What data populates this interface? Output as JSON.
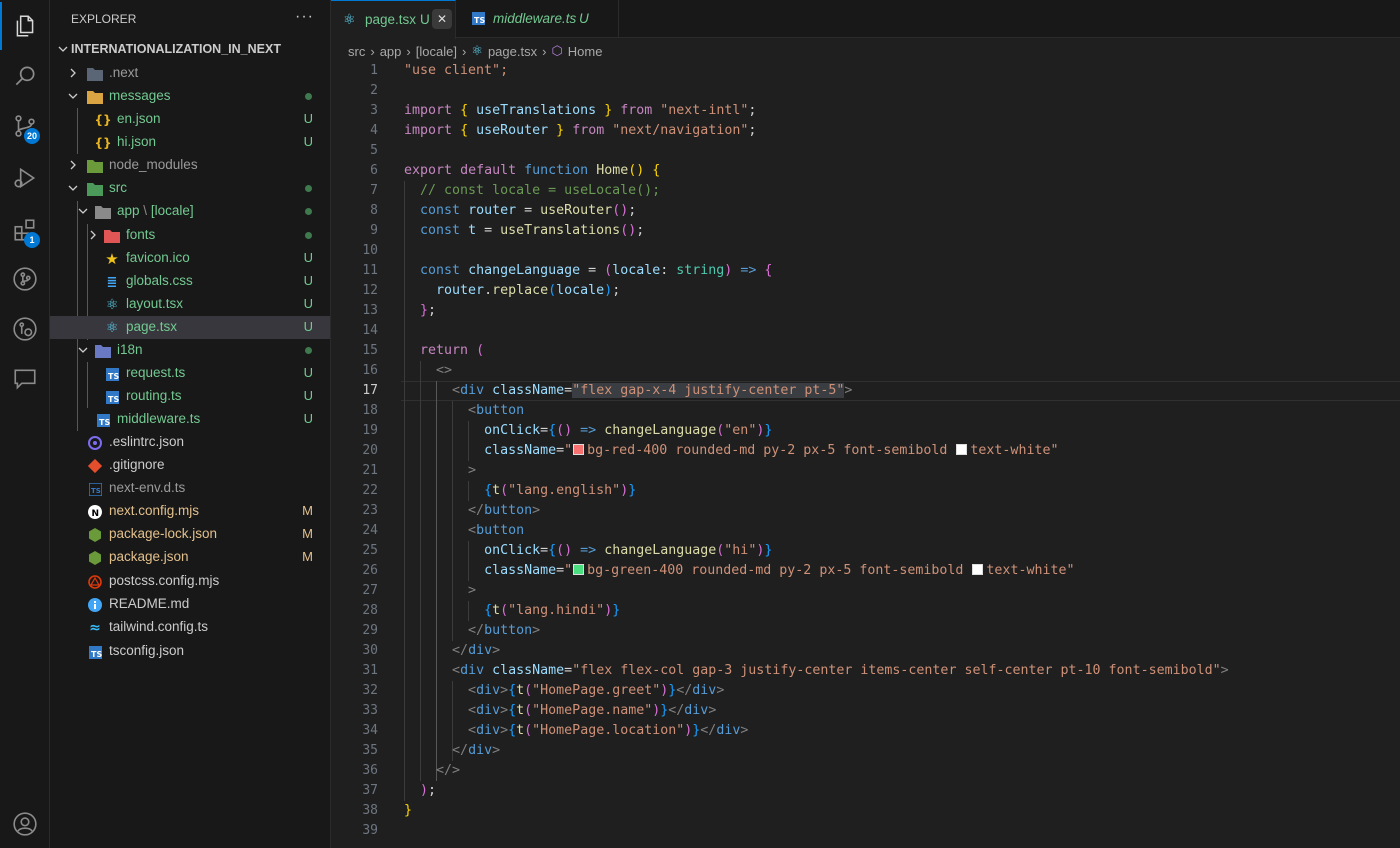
{
  "activity_bar": {
    "items": [
      {
        "name": "explorer-icon",
        "badge": ""
      },
      {
        "name": "search-icon",
        "badge": ""
      },
      {
        "name": "source-control-icon",
        "badge": "20"
      },
      {
        "name": "run-debug-icon",
        "badge": ""
      },
      {
        "name": "extensions-icon",
        "badge": "1"
      },
      {
        "name": "git-graph-icon",
        "badge": ""
      },
      {
        "name": "remote-explorer-icon",
        "badge": ""
      },
      {
        "name": "chat-icon",
        "badge": ""
      }
    ],
    "account_icon": "account-icon"
  },
  "sidebar": {
    "title": "EXPLORER",
    "more": "···",
    "root": "INTERNATIONALIZATION_IN_NEXT",
    "items": [
      {
        "name": ".next",
        "status": ""
      },
      {
        "name": "messages",
        "status": ""
      },
      {
        "name": "en.json",
        "status": "U"
      },
      {
        "name": "hi.json",
        "status": "U"
      },
      {
        "name": "node_modules",
        "status": ""
      },
      {
        "name": "src",
        "status": ""
      },
      {
        "name": "app",
        "sep": "\\",
        "sub": "[locale]",
        "status": ""
      },
      {
        "name": "fonts",
        "status": ""
      },
      {
        "name": "favicon.ico",
        "status": "U"
      },
      {
        "name": "globals.css",
        "status": "U"
      },
      {
        "name": "layout.tsx",
        "status": "U"
      },
      {
        "name": "page.tsx",
        "status": "U"
      },
      {
        "name": "i18n",
        "status": ""
      },
      {
        "name": "request.ts",
        "status": "U"
      },
      {
        "name": "routing.ts",
        "status": "U"
      },
      {
        "name": "middleware.ts",
        "status": "U"
      },
      {
        "name": ".eslintrc.json",
        "status": ""
      },
      {
        "name": ".gitignore",
        "status": ""
      },
      {
        "name": "next-env.d.ts",
        "status": ""
      },
      {
        "name": "next.config.mjs",
        "status": "M"
      },
      {
        "name": "package-lock.json",
        "status": "M"
      },
      {
        "name": "package.json",
        "status": "M"
      },
      {
        "name": "postcss.config.mjs",
        "status": ""
      },
      {
        "name": "README.md",
        "status": ""
      },
      {
        "name": "tailwind.config.ts",
        "status": ""
      },
      {
        "name": "tsconfig.json",
        "status": ""
      }
    ]
  },
  "tabs": [
    {
      "label": "page.tsx",
      "status": "U",
      "close": "✕"
    },
    {
      "label": "middleware.ts",
      "status": "U"
    }
  ],
  "breadcrumb": [
    "src",
    "app",
    "[locale]",
    "page.tsx",
    "Home"
  ],
  "editor": {
    "current_line": "17",
    "line_numbers": [
      "1",
      "2",
      "3",
      "4",
      "5",
      "6",
      "7",
      "8",
      "9",
      "10",
      "11",
      "12",
      "13",
      "14",
      "15",
      "16",
      "17",
      "18",
      "19",
      "20",
      "21",
      "22",
      "23",
      "24",
      "25",
      "26",
      "27",
      "28",
      "29",
      "30",
      "31",
      "32",
      "33",
      "34",
      "35",
      "36",
      "37",
      "38",
      "39"
    ],
    "code": {
      "l1": "\"use client\";",
      "l3a": "import",
      "l3b": "useTranslations",
      "l3c": "from",
      "l3d": "\"next-intl\"",
      "l4a": "import",
      "l4b": "useRouter",
      "l4c": "from",
      "l4d": "\"next/navigation\"",
      "l6a": "export",
      "l6b": "default",
      "l6c": "function",
      "l6d": "Home",
      "l7": "// const locale = useLocale();",
      "l8a": "const",
      "l8b": "router",
      "l8c": "useRouter",
      "l9a": "const",
      "l9b": "t",
      "l9c": "useTranslations",
      "l11a": "const",
      "l11b": "changeLanguage",
      "l11c": "locale",
      "l11d": "string",
      "l12a": "router",
      "l12b": "replace",
      "l12c": "locale",
      "l15": "return",
      "l17a": "div",
      "l17b": "className",
      "l17c": "\"flex gap-x-4 justify-center pt-5\"",
      "l18": "button",
      "l19a": "onClick",
      "l19b": "changeLanguage",
      "l19c": "\"en\"",
      "l20a": "className",
      "l20b": "bg-red-400 rounded-md py-2 px-5 font-semibold ",
      "l20c": "text-white\"",
      "l22a": "t",
      "l22b": "\"lang.english\"",
      "l23": "button",
      "l24": "button",
      "l25a": "onClick",
      "l25b": "changeLanguage",
      "l25c": "\"hi\"",
      "l26a": "className",
      "l26b": "bg-green-400 rounded-md py-2 px-5 font-semibold ",
      "l26c": "text-white\"",
      "l28a": "t",
      "l28b": "\"lang.hindi\"",
      "l29": "button",
      "l30": "div",
      "l31a": "div",
      "l31b": "className",
      "l31c": "\"flex flex-col gap-3 justify-center items-center self-center pt-10 font-semibold\"",
      "l32": "\"HomePage.greet\"",
      "l33": "\"HomePage.name\"",
      "l34": "\"HomePage.location\"",
      "l35": "div"
    },
    "swatches": {
      "red": "#f87171",
      "green": "#4ade80",
      "white": "#ffffff"
    }
  },
  "colors": {
    "accent": "#0078d4",
    "untracked": "#73c991",
    "modified": "#e2c08d"
  }
}
